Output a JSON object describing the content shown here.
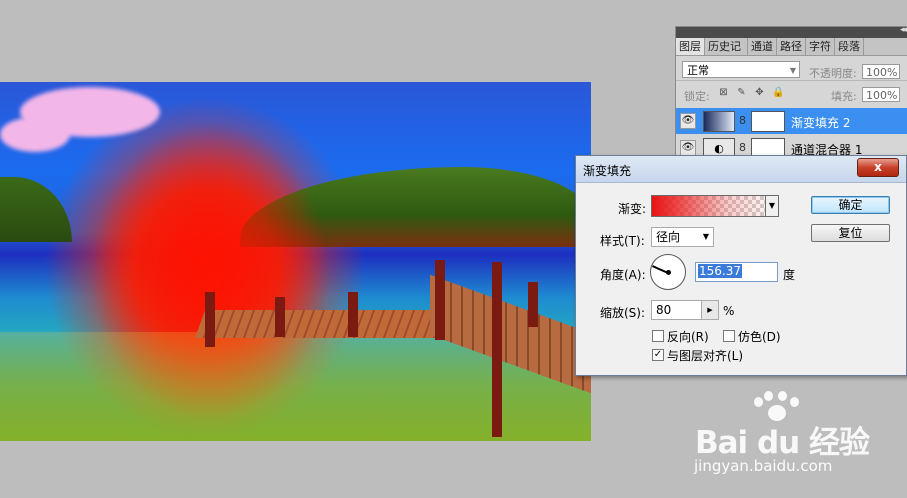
{
  "layers_panel": {
    "tabs": [
      "图层",
      "历史记",
      "通道",
      "路径",
      "字符",
      "段落"
    ],
    "blend_mode": "正常",
    "opacity_label": "不透明度:",
    "opacity_value": "100%",
    "lock_label": "锁定:",
    "fill_label": "填充:",
    "fill_value": "100%",
    "layers": [
      {
        "name": "渐变填充 2",
        "selected": true
      },
      {
        "name": "通道混合器 1",
        "selected": false
      }
    ]
  },
  "dialog": {
    "title": "渐变填充",
    "close_label": "x",
    "gradient_label": "渐变:",
    "style_label": "样式(T):",
    "style_value": "径向",
    "angle_label": "角度(A):",
    "angle_value": "156.37",
    "angle_unit": "度",
    "scale_label": "缩放(S):",
    "scale_value": "80",
    "scale_unit": "%",
    "reverse_label": "反向(R)",
    "reverse_checked": false,
    "dither_label": "仿色(D)",
    "dither_checked": false,
    "align_label": "与图层对齐(L)",
    "align_checked": true,
    "ok_label": "确定",
    "reset_label": "复位"
  },
  "watermark": {
    "brand": "Bai du 经验",
    "url": "jingyan.baidu.com"
  }
}
